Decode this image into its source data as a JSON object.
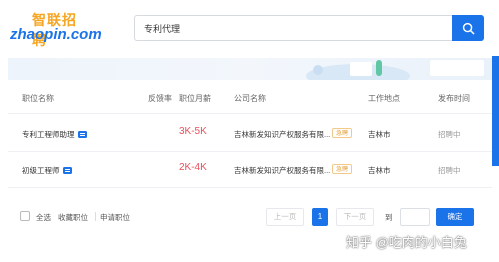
{
  "header": {
    "logo_cn": "智联招聘",
    "logo_en": "zhaopin.com",
    "search_value": "专利代理"
  },
  "table": {
    "headers": {
      "position": "职位名称",
      "feedback": "反馈率",
      "salary": "职位月薪",
      "company": "公司名称",
      "location": "工作地点",
      "date": "发布时间"
    },
    "rows": [
      {
        "title": "专利工程师助理",
        "salary": "3K-5K",
        "company": "吉林新发知识产权服务有限...",
        "badge": "急聘",
        "location": "吉林市",
        "date": "招聘中"
      },
      {
        "title": "初级工程师",
        "salary": "2K-4K",
        "company": "吉林新发知识产权服务有限...",
        "badge": "急聘",
        "location": "吉林市",
        "date": "招聘中"
      }
    ]
  },
  "footer": {
    "select_all": "全选",
    "save_position": "收藏职位",
    "apply_position": "申请职位",
    "prev": "上一页",
    "current_page": "1",
    "next": "下一页",
    "goto": "到",
    "confirm": "确定"
  },
  "watermark": "知乎 @吃肉的小白兔",
  "colors": {
    "accent": "#1a73e8",
    "salary": "#e8505b",
    "badge": "#e8a03a",
    "logo_orange": "#f5a623"
  },
  "icons": [
    "search-icon",
    "chat-icon"
  ]
}
